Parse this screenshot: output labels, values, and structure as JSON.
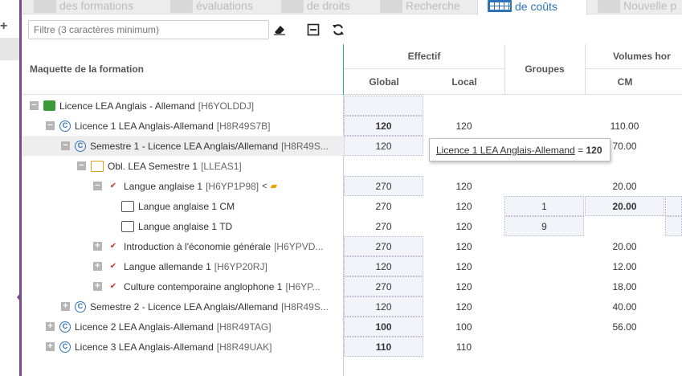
{
  "tabs": [
    {
      "label": "des formations",
      "icon": "network-icon"
    },
    {
      "label": "évaluations",
      "icon": "check-icon"
    },
    {
      "label": "de droits",
      "icon": "rights-icon"
    },
    {
      "label": "Recherche",
      "icon": "search-doc-icon"
    },
    {
      "label": "de coûts",
      "icon": "grid-icon"
    },
    {
      "label": "Nouvelle p",
      "icon": "doc-icon"
    }
  ],
  "filter": {
    "placeholder": "Filtre (3 caractères minimum)"
  },
  "header": {
    "maquette": "Maquette de la formation",
    "effectif": "Effectif",
    "global": "Global",
    "local": "Local",
    "groupes": "Groupes",
    "volumes": "Volumes hor",
    "cm": "CM"
  },
  "rows": [
    {
      "label": "Licence LEA Anglais - Allemand",
      "code": "[H6YOLDDJ]",
      "global": "",
      "local": "",
      "groupes": "",
      "cm": ""
    },
    {
      "label": "Licence 1 LEA Anglais-Allemand",
      "code": "[H8R49S7B]",
      "global": "120",
      "local": "120",
      "groupes": "",
      "cm": "110.00"
    },
    {
      "label": "Semestre 1 - Licence LEA Anglais/Allemand",
      "code": "[H8R49S...",
      "global": "120",
      "local": "",
      "groupes": "",
      "cm": "70.00"
    },
    {
      "label": "Obl. LEA Semestre 1",
      "code": "[LLEAS1]",
      "global": "",
      "local": "",
      "groupes": "",
      "cm": ""
    },
    {
      "label": "Langue anglaise 1",
      "code": "[H6YP1P98]",
      "global": "270",
      "local": "120",
      "groupes": "",
      "cm": "20.00"
    },
    {
      "label": "Langue anglaise 1 CM",
      "code": "",
      "global": "270",
      "local": "120",
      "groupes": "1",
      "cm": "20.00"
    },
    {
      "label": "Langue anglaise 1 TD",
      "code": "",
      "global": "270",
      "local": "120",
      "groupes": "9",
      "cm": ""
    },
    {
      "label": "Introduction à l'économie générale",
      "code": "[H6YPVD...",
      "global": "270",
      "local": "120",
      "groupes": "",
      "cm": "20.00"
    },
    {
      "label": "Langue allemande 1",
      "code": "[H6YP20RJ]",
      "global": "120",
      "local": "120",
      "groupes": "",
      "cm": "12.00"
    },
    {
      "label": "Culture contemporaine anglophone 1",
      "code": "[H6YP...",
      "global": "270",
      "local": "120",
      "groupes": "",
      "cm": "18.00"
    },
    {
      "label": "Semestre 2 - Licence LEA Anglais/Allemand",
      "code": "[H8R49S...",
      "global": "120",
      "local": "120",
      "groupes": "",
      "cm": "40.00"
    },
    {
      "label": "Licence 2 LEA Anglais-Allemand",
      "code": "[H8R49TAG]",
      "global": "100",
      "local": "100",
      "groupes": "",
      "cm": "56.00"
    },
    {
      "label": "Licence 3 LEA Anglais-Allemand",
      "code": "[H8R49UAK]",
      "global": "110",
      "local": "110",
      "groupes": "",
      "cm": ""
    }
  ],
  "tooltip": {
    "label": "Licence 1 LEA Anglais-Allemand",
    "equals": " = ",
    "value": "120"
  }
}
